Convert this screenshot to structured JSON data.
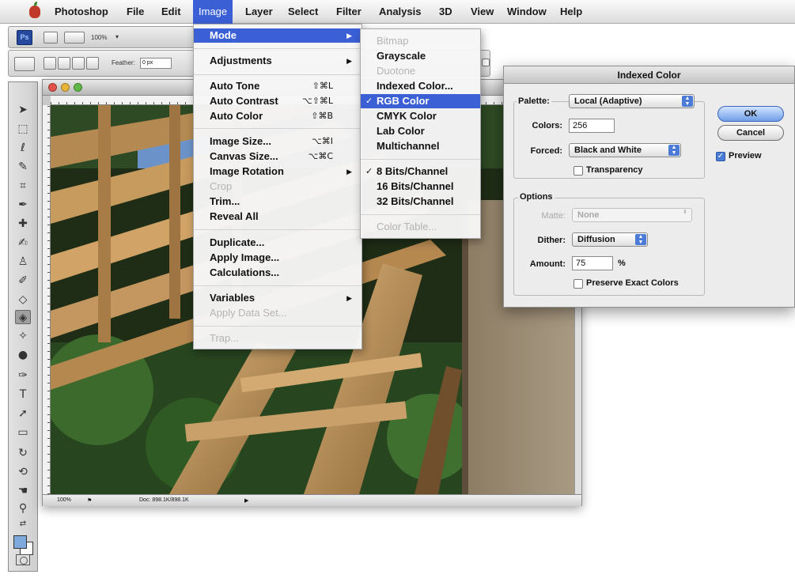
{
  "menubar": {
    "items": [
      "Photoshop",
      "File",
      "Edit",
      "Image",
      "Layer",
      "Select",
      "Filter",
      "Analysis",
      "3D",
      "View",
      "Window",
      "Help"
    ],
    "active_item": "Image"
  },
  "appbar": {
    "logo": "Ps",
    "zoom": "100%"
  },
  "optbar": {
    "feather_label": "Feather:",
    "feather_value": "0 px"
  },
  "image_menu": [
    {
      "label": "Mode",
      "submenu": true,
      "highlighted": true
    },
    {
      "label": "Adjustments",
      "submenu": true
    },
    {
      "label": "Auto Tone",
      "shortcut": "⇧⌘L"
    },
    {
      "label": "Auto Contrast",
      "shortcut": "⌥⇧⌘L"
    },
    {
      "label": "Auto Color",
      "shortcut": "⇧⌘B"
    },
    {
      "label": "Image Size...",
      "shortcut": "⌥⌘I"
    },
    {
      "label": "Canvas Size...",
      "shortcut": "⌥⌘C"
    },
    {
      "label": "Image Rotation",
      "submenu": true
    },
    {
      "label": "Crop",
      "disabled": true
    },
    {
      "label": "Trim..."
    },
    {
      "label": "Reveal All"
    },
    {
      "label": "Duplicate..."
    },
    {
      "label": "Apply Image..."
    },
    {
      "label": "Calculations..."
    },
    {
      "label": "Variables",
      "submenu": true
    },
    {
      "label": "Apply Data Set...",
      "disabled": true
    },
    {
      "label": "Trap...",
      "disabled": true
    }
  ],
  "mode_menu": [
    {
      "label": "Bitmap",
      "disabled": true
    },
    {
      "label": "Grayscale"
    },
    {
      "label": "Duotone",
      "disabled": true
    },
    {
      "label": "Indexed Color..."
    },
    {
      "label": "RGB Color",
      "checked": true,
      "highlighted": true
    },
    {
      "label": "CMYK Color"
    },
    {
      "label": "Lab Color"
    },
    {
      "label": "Multichannel"
    },
    {
      "label": "8 Bits/Channel",
      "checked": true
    },
    {
      "label": "16 Bits/Channel"
    },
    {
      "label": "32 Bits/Channel"
    },
    {
      "label": "Color Table...",
      "disabled": true
    }
  ],
  "document": {
    "zoom": "100%",
    "doc_size": "Doc: 898.1K/898.1K"
  },
  "dialog": {
    "title": "Indexed Color",
    "palette_label": "Palette:",
    "palette_value": "Local (Adaptive)",
    "colors_label": "Colors:",
    "colors_value": "256",
    "forced_label": "Forced:",
    "forced_value": "Black and White",
    "transparency_label": "Transparency",
    "transparency_checked": false,
    "options_label": "Options",
    "matte_label": "Matte:",
    "matte_value": "None",
    "dither_label": "Dither:",
    "dither_value": "Diffusion",
    "amount_label": "Amount:",
    "amount_value": "75",
    "amount_unit": "%",
    "preserve_label": "Preserve Exact Colors",
    "preserve_checked": false,
    "ok_label": "OK",
    "cancel_label": "Cancel",
    "preview_label": "Preview",
    "preview_checked": true
  },
  "colors": {
    "menu_highlight": "#3b60d6",
    "foreground_swatch": "#7ea9dd",
    "background_swatch": "#ffffff"
  }
}
